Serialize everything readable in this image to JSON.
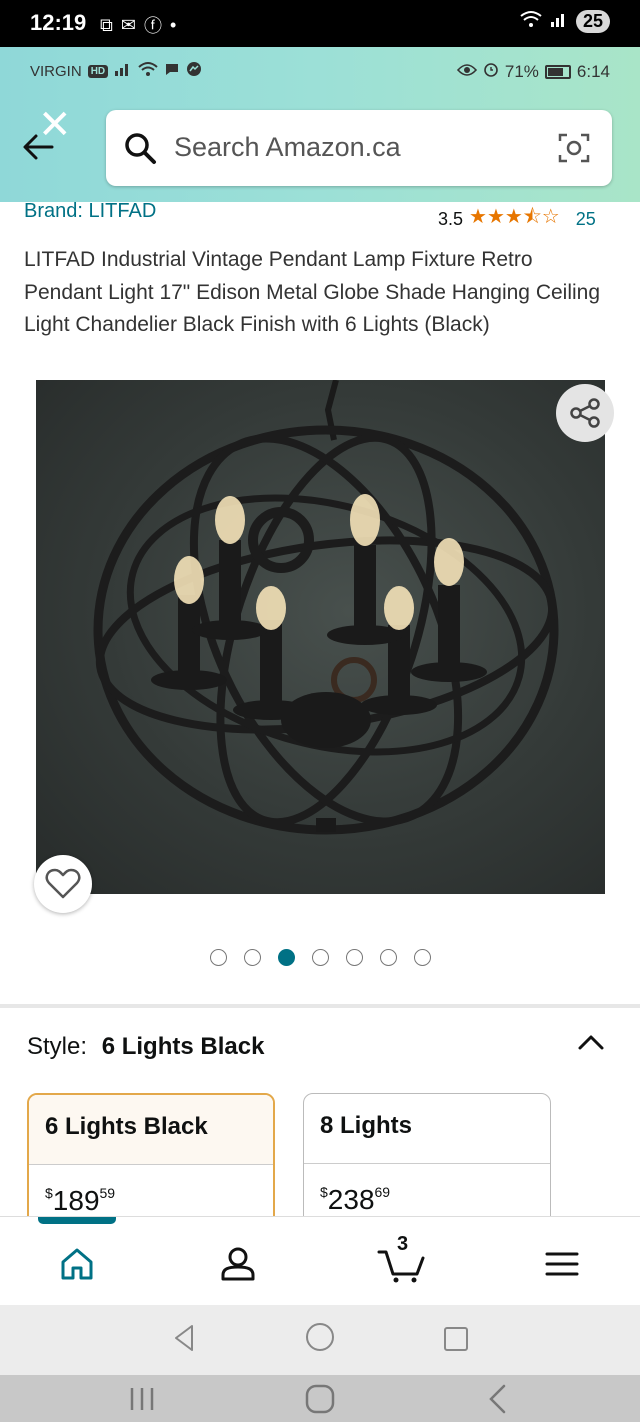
{
  "outer_status": {
    "time": "12:19",
    "battery_badge": "25"
  },
  "inner_status": {
    "carrier": "VIRGIN",
    "hd_label": "HD",
    "battery_pct": "71%",
    "time": "6:14"
  },
  "search": {
    "placeholder": "Search Amazon.ca"
  },
  "product": {
    "brand": "Brand: LITFAD",
    "rating_value": "3.5",
    "rating_stars": 3.5,
    "rating_count": "25",
    "title": "LITFAD Industrial Vintage Pendant Lamp Fixture Retro Pendant Light 17\" Edison Metal Globe Shade Hanging Ceiling Light Chandelier Black Finish with 6 Lights (Black)",
    "image_count": 7,
    "active_image_index": 2
  },
  "style_selector": {
    "label": "Style:",
    "selected": "6 Lights Black",
    "options": [
      {
        "name": "6 Lights Black",
        "price_currency": "$",
        "price_whole": "189",
        "price_cents": "59",
        "selected": true
      },
      {
        "name": "8 Lights",
        "price_currency": "$",
        "price_whole": "238",
        "price_cents": "69",
        "selected": false
      }
    ]
  },
  "bottom_nav": {
    "cart_count": "3",
    "active": "home"
  },
  "colors": {
    "accent_teal": "#007185",
    "star_orange": "#e77600",
    "selected_border": "#e3a84a",
    "header_gradient_start": "#8fd8d8",
    "header_gradient_end": "#a9e5c8"
  }
}
